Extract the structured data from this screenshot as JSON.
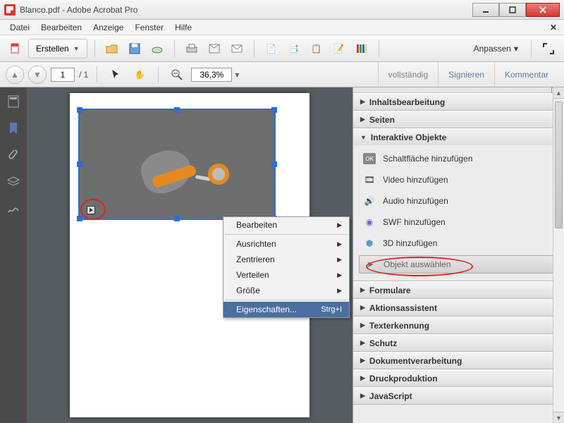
{
  "window": {
    "title": "Blanco.pdf - Adobe Acrobat Pro"
  },
  "menubar": [
    "Datei",
    "Bearbeiten",
    "Anzeige",
    "Fenster",
    "Hilfe"
  ],
  "toolbar": {
    "create_label": "Erstellen",
    "customize_label": "Anpassen"
  },
  "nav": {
    "page_current": "1",
    "page_total": "/ 1",
    "zoom": "36,3%"
  },
  "side_tabs": {
    "full": "vollständig",
    "sign": "Signieren",
    "comment": "Kommentar"
  },
  "context_menu": {
    "items": [
      {
        "label": "Bearbeiten",
        "submenu": true
      },
      {
        "sep": true
      },
      {
        "label": "Ausrichten",
        "submenu": true
      },
      {
        "label": "Zentrieren",
        "submenu": true
      },
      {
        "label": "Verteilen",
        "submenu": true
      },
      {
        "label": "Größe",
        "submenu": true
      },
      {
        "sep": true
      },
      {
        "label": "Eigenschaften...",
        "shortcut": "Strg+I",
        "highlight": true
      }
    ]
  },
  "right_panel": {
    "sections": {
      "content_edit": "Inhaltsbearbeitung",
      "pages": "Seiten",
      "interactive": "Interaktive Objekte",
      "forms": "Formulare",
      "actions": "Aktionsassistent",
      "ocr": "Texterkennung",
      "security": "Schutz",
      "docproc": "Dokumentverarbeitung",
      "print": "Druckproduktion",
      "js": "JavaScript"
    },
    "interactive_tools": {
      "button": "Schaltfläche hinzufügen",
      "video": "Video hinzufügen",
      "audio": "Audio hinzufügen",
      "swf": "SWF hinzufügen",
      "three_d": "3D hinzufügen",
      "select": "Objekt auswählen"
    }
  }
}
